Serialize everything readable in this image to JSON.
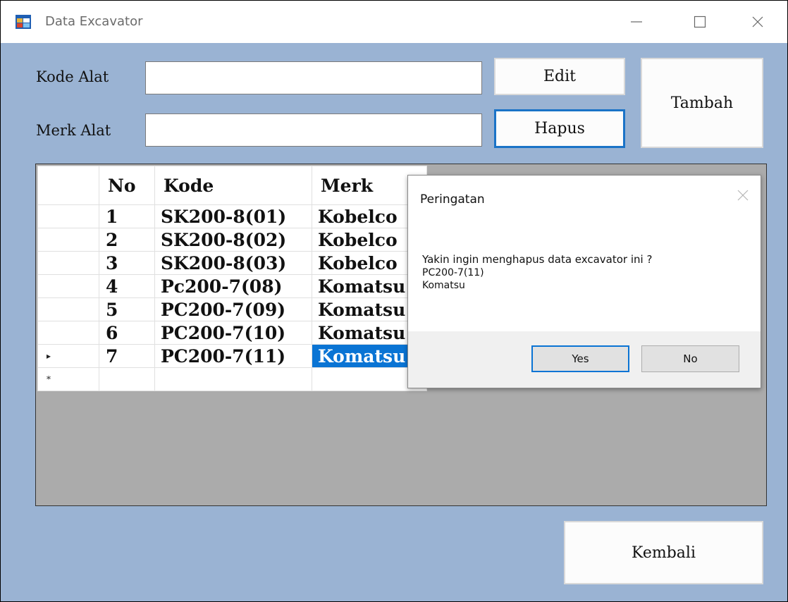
{
  "window": {
    "title": "Data Excavator"
  },
  "form": {
    "kode_label": "Kode Alat",
    "merk_label": "Merk Alat",
    "kode_value": "",
    "merk_value": "",
    "edit_label": "Edit",
    "hapus_label": "Hapus",
    "tambah_label": "Tambah",
    "kembali_label": "Kembali"
  },
  "table": {
    "columns": [
      "No",
      "Kode",
      "Merk"
    ],
    "rows": [
      {
        "no": "1",
        "kode": "SK200-8(01)",
        "merk": "Kobelco"
      },
      {
        "no": "2",
        "kode": "SK200-8(02)",
        "merk": "Kobelco"
      },
      {
        "no": "3",
        "kode": "SK200-8(03)",
        "merk": "Kobelco"
      },
      {
        "no": "4",
        "kode": "Pc200-7(08)",
        "merk": "Komatsu"
      },
      {
        "no": "5",
        "kode": "PC200-7(09)",
        "merk": "Komatsu"
      },
      {
        "no": "6",
        "kode": "PC200-7(10)",
        "merk": "Komatsu"
      },
      {
        "no": "7",
        "kode": "PC200-7(11)",
        "merk": "Komatsu"
      }
    ],
    "current_row_marker": "▸",
    "new_row_marker": "*"
  },
  "dialog": {
    "title": "Peringatan",
    "message": "Yakin ingin menghapus data excavator ini ?",
    "line2": "PC200-7(11)",
    "line3": "Komatsu",
    "yes_label": "Yes",
    "no_label": "No"
  },
  "icons": {
    "app": "app-icon",
    "minimize": "minimize-icon",
    "maximize": "maximize-icon",
    "close": "close-icon",
    "dialog_close": "close-icon"
  },
  "colors": {
    "form_background": "#9ab3d3",
    "selection": "#0a74d4",
    "grid_background": "#ababab"
  }
}
